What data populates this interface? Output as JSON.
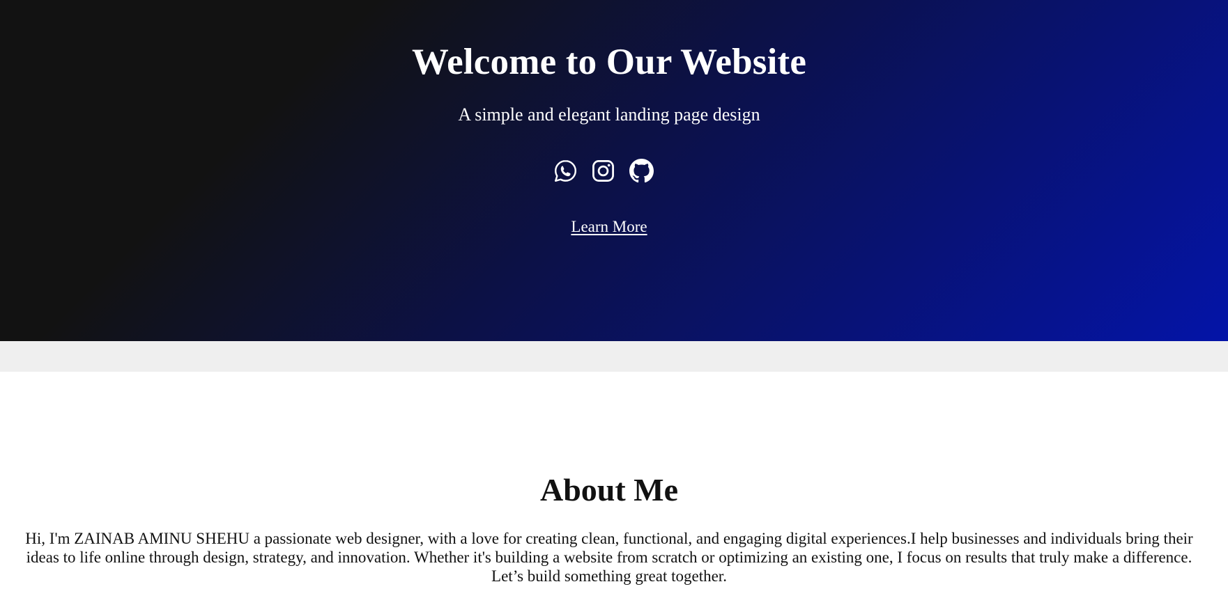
{
  "hero": {
    "title": "Welcome to Our Website",
    "subtitle": "A simple and elegant landing page design",
    "social": [
      {
        "name": "whatsapp-icon",
        "label": "WhatsApp"
      },
      {
        "name": "instagram-icon",
        "label": "Instagram"
      },
      {
        "name": "github-icon",
        "label": "GitHub"
      }
    ],
    "cta_label": "Learn More"
  },
  "about": {
    "title": "About Me",
    "text": "Hi, I'm ZAINAB AMINU SHEHU a passionate web designer, with a love for creating clean, functional, and engaging digital experiences.I help businesses and individuals bring their ideas to life online through design, strategy, and innovation. Whether it's building a website from scratch or optimizing an existing one, I focus on results that truly make a difference. Let’s build something great together."
  },
  "colors": {
    "hero_gradient_start": "#121212",
    "hero_gradient_mid": "#0b1150",
    "hero_gradient_end": "#0414a8",
    "band": "#efefef",
    "text_light": "#ffffff",
    "text_dark": "#111111"
  }
}
